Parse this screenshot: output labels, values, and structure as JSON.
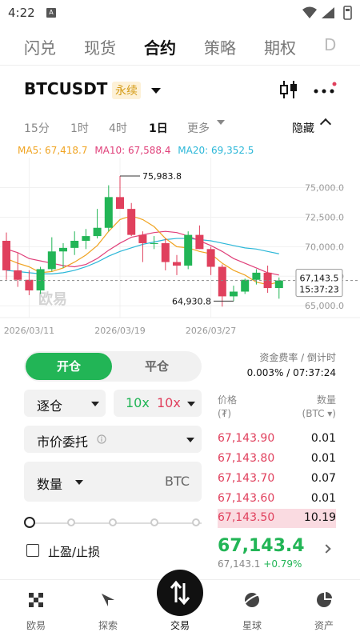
{
  "status": {
    "time": "4:22",
    "sim_label": "A"
  },
  "topnav": {
    "tabs": [
      "闪兑",
      "现货",
      "合约",
      "策略",
      "期权",
      "D"
    ],
    "active": 2
  },
  "symbol": {
    "name": "BTCUSDT",
    "badge": "永续"
  },
  "intervals": {
    "items": [
      "15分",
      "1时",
      "4时",
      "1日",
      "更多"
    ],
    "active": 3,
    "hide_label": "隐藏"
  },
  "ma": {
    "ma5": "MA5: 67,418.7",
    "ma10": "MA10: 67,588.4",
    "ma20": "MA20: 69,352.5"
  },
  "colors": {
    "green": "#22b556",
    "red": "#e0405d",
    "ma5": "#f0a422",
    "ma10": "#e0407a",
    "ma20": "#2bb7d8"
  },
  "chart_data": {
    "type": "candlestick",
    "y_ticks": [
      "75,000.0",
      "72,500.0",
      "70,000.0",
      "67,500.0",
      "65,000.0"
    ],
    "ylim": [
      64000,
      77000
    ],
    "x_ticks": [
      {
        "label": "2026/03/11",
        "idx": 2
      },
      {
        "label": "2026/03/19",
        "idx": 10
      },
      {
        "label": "2026/03/27",
        "idx": 18
      }
    ],
    "high_label": "75,983.8",
    "low_label": "64,930.8",
    "high_idx": 10,
    "low_idx": 20,
    "last_price": "67,143.5",
    "countdown": "15:37:23",
    "last_price_value": 67143.5,
    "watermark": "欧易",
    "candles": [
      {
        "o": 70500,
        "h": 71200,
        "l": 67200,
        "c": 68000
      },
      {
        "o": 68000,
        "h": 69500,
        "l": 66600,
        "c": 67200
      },
      {
        "o": 67200,
        "h": 68000,
        "l": 65900,
        "c": 66300
      },
      {
        "o": 66300,
        "h": 68300,
        "l": 66000,
        "c": 68100
      },
      {
        "o": 68100,
        "h": 70800,
        "l": 67900,
        "c": 69600
      },
      {
        "o": 69600,
        "h": 70300,
        "l": 68200,
        "c": 69900
      },
      {
        "o": 69900,
        "h": 71300,
        "l": 69300,
        "c": 70500
      },
      {
        "o": 70500,
        "h": 71500,
        "l": 69800,
        "c": 70900
      },
      {
        "o": 70900,
        "h": 73200,
        "l": 70700,
        "c": 71600
      },
      {
        "o": 71600,
        "h": 75200,
        "l": 71300,
        "c": 74200
      },
      {
        "o": 74200,
        "h": 75983.8,
        "l": 73500,
        "c": 73200
      },
      {
        "o": 73200,
        "h": 73700,
        "l": 70900,
        "c": 71000
      },
      {
        "o": 71000,
        "h": 71300,
        "l": 68700,
        "c": 70300
      },
      {
        "o": 70300,
        "h": 70900,
        "l": 69800,
        "c": 70300
      },
      {
        "o": 70300,
        "h": 70700,
        "l": 68000,
        "c": 68700
      },
      {
        "o": 68700,
        "h": 69300,
        "l": 67600,
        "c": 68400
      },
      {
        "o": 68400,
        "h": 71300,
        "l": 68100,
        "c": 71000
      },
      {
        "o": 71000,
        "h": 71800,
        "l": 69800,
        "c": 69800
      },
      {
        "o": 69800,
        "h": 70000,
        "l": 67600,
        "c": 68300
      },
      {
        "o": 68300,
        "h": 68500,
        "l": 64930.8,
        "c": 65800
      },
      {
        "o": 65800,
        "h": 66700,
        "l": 65400,
        "c": 66200
      },
      {
        "o": 66200,
        "h": 67300,
        "l": 66000,
        "c": 67200
      },
      {
        "o": 67200,
        "h": 68100,
        "l": 66800,
        "c": 67800
      },
      {
        "o": 67800,
        "h": 68400,
        "l": 66100,
        "c": 66500
      },
      {
        "o": 66500,
        "h": 67400,
        "l": 65600,
        "c": 67143.5
      }
    ],
    "ma5": [
      69000,
      68600,
      68300,
      67800,
      67900,
      68200,
      68700,
      69300,
      70100,
      71300,
      72300,
      72600,
      72300,
      71700,
      70700,
      70000,
      69900,
      69600,
      69400,
      68600,
      68000,
      67600,
      67000,
      66800,
      67000
    ],
    "ma10": [
      69800,
      69500,
      69000,
      68800,
      68600,
      68400,
      68300,
      68500,
      69000,
      69700,
      70300,
      70800,
      71000,
      71200,
      71300,
      71200,
      70900,
      70500,
      70100,
      69600,
      69000,
      68600,
      68200,
      67800,
      67600
    ],
    "ma20": [
      68000,
      67900,
      67800,
      67700,
      67700,
      67800,
      68000,
      68300,
      68700,
      69200,
      69600,
      69900,
      70200,
      70400,
      70600,
      70700,
      70700,
      70600,
      70500,
      70300,
      70100,
      69900,
      69800,
      69600,
      69400
    ]
  },
  "trade": {
    "open_label": "开仓",
    "close_label": "平仓",
    "margin_mode": "逐仓",
    "lev_long": "10x",
    "lev_short": "10x",
    "order_type": "市价委托",
    "qty_label": "数量",
    "qty_unit": "BTC",
    "slider_pct": 0,
    "tpsl_label": "止盈/止损"
  },
  "funding": {
    "label": "资金费率 / 倒计时",
    "value": "0.003% / 07:37:24"
  },
  "orderbook": {
    "price_header": "价格",
    "price_unit": "(₮)",
    "qty_header": "数量",
    "qty_unit": "(BTC ▾)",
    "asks": [
      {
        "p": "67,143.90",
        "q": "0.01"
      },
      {
        "p": "67,143.80",
        "q": "0.01"
      },
      {
        "p": "67,143.70",
        "q": "0.07"
      },
      {
        "p": "67,143.60",
        "q": "0.01"
      },
      {
        "p": "67,143.50",
        "q": "10.19"
      }
    ],
    "last": "67,143.4",
    "index": "67,143.1",
    "change": "+0.79%"
  },
  "bottomnav": {
    "items": [
      "欧易",
      "探索",
      "交易",
      "星球",
      "资产"
    ],
    "active": 2
  }
}
